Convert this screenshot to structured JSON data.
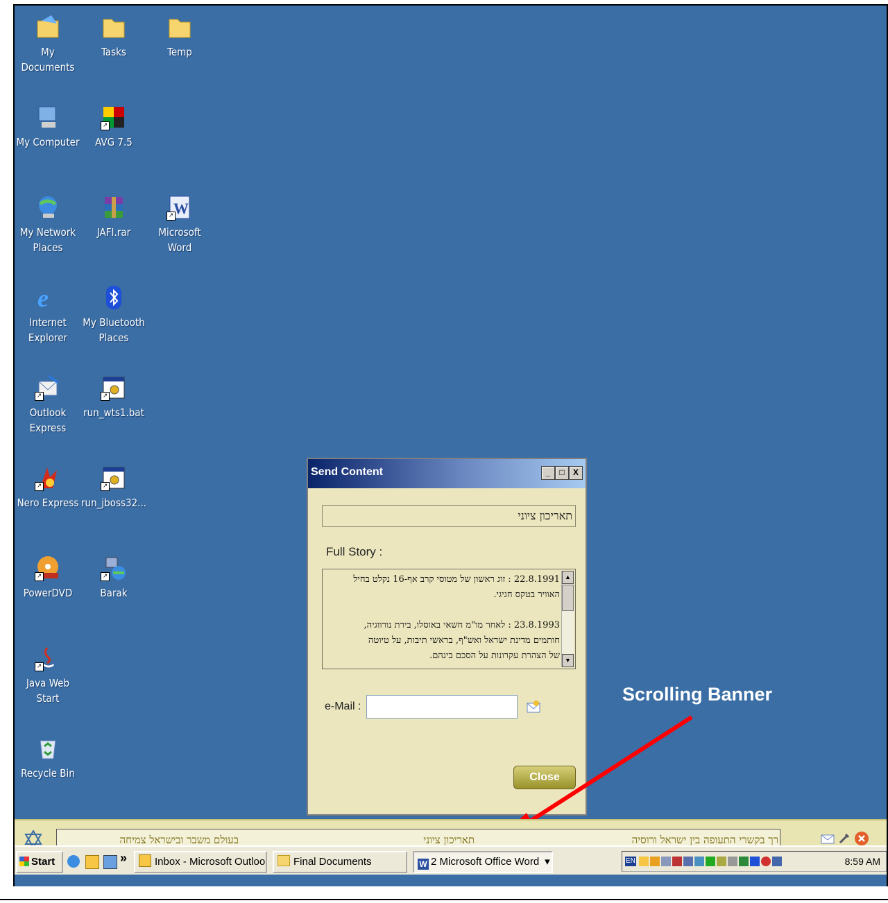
{
  "desktop": {
    "icons": [
      {
        "id": "my-documents",
        "label": "My Documents"
      },
      {
        "id": "tasks",
        "label": "Tasks"
      },
      {
        "id": "temp",
        "label": "Temp"
      },
      {
        "id": "my-computer",
        "label": "My Computer"
      },
      {
        "id": "avg",
        "label": "AVG 7.5"
      },
      {
        "id": "network",
        "label": "My Network Places"
      },
      {
        "id": "jafi",
        "label": "JAFI.rar"
      },
      {
        "id": "word",
        "label": "Microsoft Word"
      },
      {
        "id": "ie",
        "label": "Internet Explorer"
      },
      {
        "id": "bluetooth",
        "label": "My Bluetooth Places"
      },
      {
        "id": "outlook-express",
        "label": "Outlook Express"
      },
      {
        "id": "run-wts",
        "label": "run_wts1.bat"
      },
      {
        "id": "nero",
        "label": "Nero Express"
      },
      {
        "id": "run-jboss",
        "label": "run_jboss32..."
      },
      {
        "id": "powerdvd",
        "label": "PowerDVD"
      },
      {
        "id": "barak",
        "label": "Barak"
      },
      {
        "id": "java",
        "label": "Java Web Start"
      },
      {
        "id": "recycle",
        "label": "Recycle Bin"
      }
    ]
  },
  "dialog": {
    "title": "Send Content",
    "subject_value": "תאריכון ציוני",
    "full_story_label": "Full Story :",
    "story_text": [
      "22.8.1991 : זוג ראשון של מטוסי קרב אף-16 נקלט בחיל",
      "האוויר בטקס חגיגי.",
      "",
      "23.8.1993 : לאחר מו\"מ חשאי באוסלו, בירת נורווגיה,",
      "חותמים מדינת ישראל ואש\"ף, בראשי תיבות, על טיוטה",
      "של הצהרת עקרונות על הסכם בינהם."
    ],
    "email_label": "e-Mail :",
    "email_value": "",
    "close_label": "Close",
    "min_label": "_",
    "max_label": "□",
    "x_label": "X"
  },
  "annotation": {
    "label": "Scrolling Banner",
    "color": "#ff0000"
  },
  "banner": {
    "segments": [
      "בעולם משבר ובישראל צמיחה",
      "תאריכון ציוני",
      "רך בקשרי התעופה בין ישראל ורוסיה"
    ]
  },
  "taskbar": {
    "start_label": "Start",
    "chevron": "»",
    "tasks": [
      {
        "label": "Inbox - Microsoft Outlook"
      },
      {
        "label": "Final Documents"
      },
      {
        "label": "2 Microsoft Office Word"
      }
    ],
    "lang": "EN",
    "clock": "8:59 AM"
  }
}
